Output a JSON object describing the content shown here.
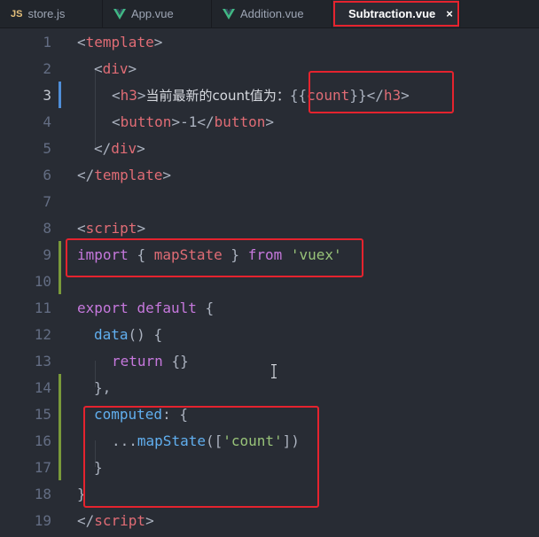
{
  "tabs": [
    {
      "label": "store.js",
      "icon": "js-file-icon",
      "icon_text": "JS",
      "active": false
    },
    {
      "label": "App.vue",
      "icon": "vue-file-icon",
      "active": false
    },
    {
      "label": "Addition.vue",
      "icon": "vue-file-icon",
      "active": false
    },
    {
      "label": "Subtraction.vue",
      "icon": "vue-file-icon",
      "active": true,
      "close_glyph": "×"
    }
  ],
  "colors": {
    "background": "#282c34",
    "tag": "#e06c75",
    "keyword": "#c678dd",
    "function": "#61afef",
    "string": "#98c379",
    "highlight_box": "#e5232e",
    "vue_logo": "#41b883"
  },
  "code": {
    "line_numbers": [
      "1",
      "2",
      "3",
      "4",
      "5",
      "6",
      "7",
      "8",
      "9",
      "10",
      "11",
      "12",
      "13",
      "14",
      "15",
      "16",
      "17",
      "18",
      "19"
    ],
    "current_line": "3",
    "l1": {
      "open": "<",
      "tag": "template",
      "close": ">"
    },
    "l2": {
      "open": "<",
      "tag": "div",
      "close": ">"
    },
    "l3": {
      "open": "<",
      "tag": "h3",
      "close": ">",
      "text": "当前最新的count值为：",
      "mustache_open": "{{",
      "var": "count",
      "mustache_close": "}}",
      "end_open": "</",
      "end_tag": "h3",
      "end_close": ">"
    },
    "l4": {
      "open": "<",
      "tag": "button",
      "close": ">",
      "text": "-1",
      "end_open": "</",
      "end_tag": "button",
      "end_close": ">"
    },
    "l5": {
      "open": "</",
      "tag": "div",
      "close": ">"
    },
    "l6": {
      "open": "</",
      "tag": "template",
      "close": ">"
    },
    "l8": {
      "open": "<",
      "tag": "script",
      "close": ">"
    },
    "l9": {
      "kw_import": "import",
      "brace_open": "{",
      "name": "mapState",
      "brace_close": "}",
      "kw_from": "from",
      "module": "'vuex'"
    },
    "l11": {
      "kw_export": "export",
      "kw_default": "default",
      "brace": "{"
    },
    "l12": {
      "fn": "data",
      "parens": "()",
      "brace": "{"
    },
    "l13": {
      "kw_return": "return",
      "obj": "{}"
    },
    "l14": {
      "text": "},"
    },
    "l15": {
      "prop": "computed",
      "colon": ":",
      "brace": "{"
    },
    "l16": {
      "spread": "...",
      "fn": "mapState",
      "open": "([",
      "str": "'count'",
      "close": "])"
    },
    "l17": {
      "text": "}"
    },
    "l18": {
      "text": "}"
    },
    "l19": {
      "open": "</",
      "tag": "script",
      "close": ">"
    }
  }
}
